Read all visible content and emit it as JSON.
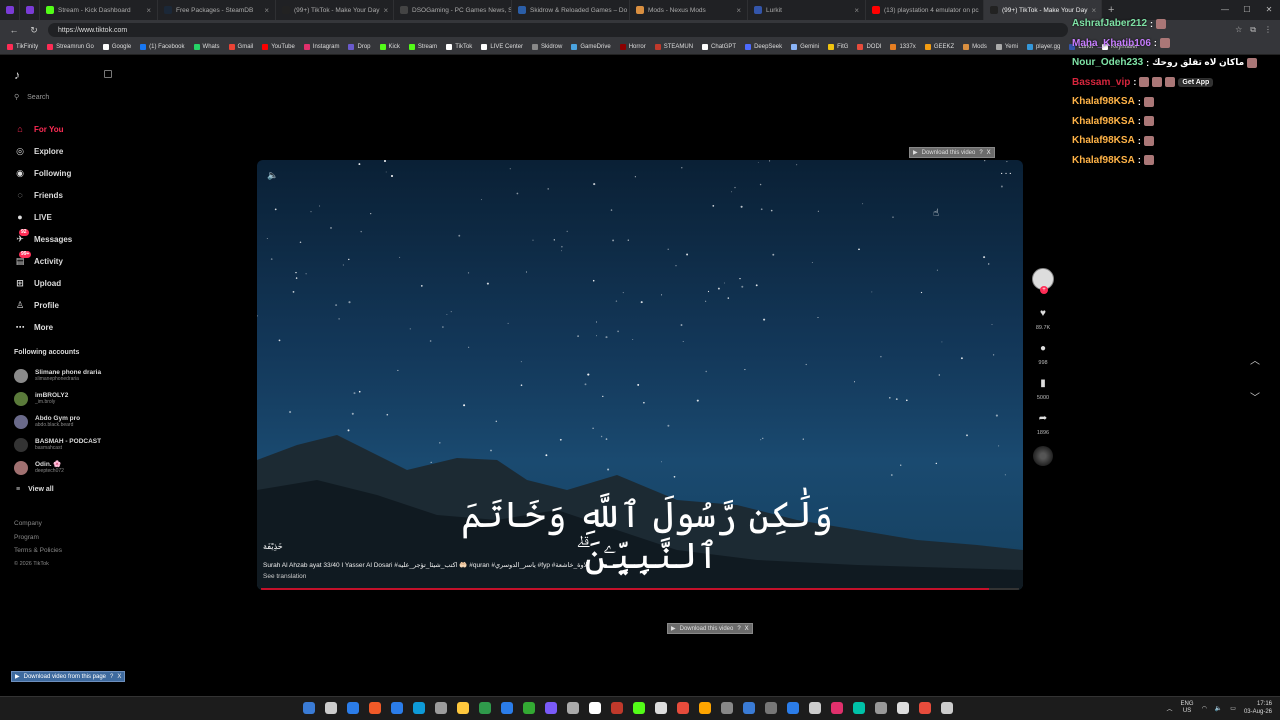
{
  "browser": {
    "tabs": [
      {
        "label": "",
        "color": "#7a3bd6"
      },
      {
        "label": "",
        "color": "#7a3bd6"
      },
      {
        "label": "Stream - Kick Dashboard",
        "color": "#53fc18"
      },
      {
        "label": "Free Packages - SteamDB",
        "color": "#1b2838"
      },
      {
        "label": "(99+) TikTok - Make Your Day",
        "color": "#222222"
      },
      {
        "label": "DSOGaming - PC Games News, S",
        "color": "#444444"
      },
      {
        "label": "Skidrow & Reloaded Games – Do",
        "color": "#2b5ea7"
      },
      {
        "label": "Mods - Nexus Mods",
        "color": "#d98f40"
      },
      {
        "label": "Lurkit",
        "color": "#3355aa"
      },
      {
        "label": "(13) playstation 4 emulator on pc",
        "color": "#ff0000"
      },
      {
        "label": "(99+) TikTok - Make Your Day",
        "color": "#222222"
      }
    ],
    "url": "https://www.tiktok.com",
    "bookmarks": [
      {
        "label": "TikFinity",
        "color": "#fe2c55"
      },
      {
        "label": "Streamrun Go",
        "color": "#fe2c55"
      },
      {
        "label": "Google",
        "color": "#ffffff"
      },
      {
        "label": "(1) Facebook",
        "color": "#1877f2"
      },
      {
        "label": "Whats",
        "color": "#25d366"
      },
      {
        "label": "Gmail",
        "color": "#ea4335"
      },
      {
        "label": "YouTube",
        "color": "#ff0000"
      },
      {
        "label": "Instagram",
        "color": "#e1306c"
      },
      {
        "label": "Drop",
        "color": "#6a5acd"
      },
      {
        "label": "Kick",
        "color": "#53fc18"
      },
      {
        "label": "Stream",
        "color": "#53fc18"
      },
      {
        "label": "TikTok",
        "color": "#ffffff"
      },
      {
        "label": "LIVE Center",
        "color": "#ffffff"
      },
      {
        "label": "Skidrow",
        "color": "#888888"
      },
      {
        "label": "GameDrive",
        "color": "#4aa3df"
      },
      {
        "label": "Horror",
        "color": "#8b0000"
      },
      {
        "label": "STEAMUN",
        "color": "#c0392b"
      },
      {
        "label": "ChatGPT",
        "color": "#ffffff"
      },
      {
        "label": "DeepSeek",
        "color": "#4d6bfe"
      },
      {
        "label": "Gemini",
        "color": "#8ab4f8"
      },
      {
        "label": "FitG",
        "color": "#f1c40f"
      },
      {
        "label": "DODI",
        "color": "#e74c3c"
      },
      {
        "label": "1337x",
        "color": "#e67e22"
      },
      {
        "label": "GEEKZ",
        "color": "#f39c12"
      },
      {
        "label": "Mods",
        "color": "#d98f40"
      },
      {
        "label": "Yemi",
        "color": "#aaaaaa"
      },
      {
        "label": "player.gg",
        "color": "#3498db"
      },
      {
        "label": "Lurkit",
        "color": "#3355aa"
      },
      {
        "label": "Keymailer",
        "color": "#ffffff"
      }
    ]
  },
  "sidebar": {
    "search_placeholder": "Search",
    "nav": [
      {
        "label": "For You",
        "icon": "home-icon",
        "glyph": "⌂",
        "active": true,
        "badge": ""
      },
      {
        "label": "Explore",
        "icon": "compass-icon",
        "glyph": "◎",
        "active": false,
        "badge": ""
      },
      {
        "label": "Following",
        "icon": "following-icon",
        "glyph": "◉",
        "active": false,
        "badge": ""
      },
      {
        "label": "Friends",
        "icon": "friends-icon",
        "glyph": "◌",
        "active": false,
        "badge": ""
      },
      {
        "label": "LIVE",
        "icon": "live-icon",
        "glyph": "●",
        "active": false,
        "badge": ""
      },
      {
        "label": "Messages",
        "icon": "messages-icon",
        "glyph": "✈",
        "active": false,
        "badge": "92"
      },
      {
        "label": "Activity",
        "icon": "activity-icon",
        "glyph": "▤",
        "active": false,
        "badge": "99+"
      },
      {
        "label": "Upload",
        "icon": "upload-icon",
        "glyph": "⊞",
        "active": false,
        "badge": ""
      },
      {
        "label": "Profile",
        "icon": "profile-icon",
        "glyph": "♙",
        "active": false,
        "badge": ""
      },
      {
        "label": "More",
        "icon": "more-icon",
        "glyph": "⋯",
        "active": false,
        "badge": ""
      }
    ],
    "following_title": "Following accounts",
    "accounts": [
      {
        "name": "Slimane phone draria",
        "handle": "slimanephonedraria"
      },
      {
        "name": "imBROLY2",
        "handle": "_im.broly"
      },
      {
        "name": "Abdo Gym pro",
        "handle": "abdo.black.beard"
      },
      {
        "name": "BASMAH - PODCAST",
        "handle": "basmahcast"
      },
      {
        "name": "Odin. 🌸",
        "handle": "deeptech072"
      }
    ],
    "view_all": "View all",
    "footer": {
      "company": "Company",
      "program": "Program",
      "terms": "Terms & Policies",
      "copyright": "© 2026 TikTok"
    }
  },
  "video": {
    "overlay_text": "وَلَٰكِن رَّسُولَ ٱللَّهِ وَخَاتَمَ ٱلنَّبِيِّـۧنَ ۗ",
    "author": "خَذِيْفَة",
    "caption": "Surah Al Ahzab ayat 33/40 I Yasser Al Dosari #اكتب_شيئا_تؤجر_عليه 🤲🏻 #quran #ياسر_الدوسري #fyp #تلاوة_خاشعة",
    "see_translation": "See translation",
    "progress": 0.96
  },
  "actions": {
    "likes": "89.7K",
    "comments": "998",
    "saves": "5000",
    "shares": "1896"
  },
  "download_buttons": {
    "video": "Download this video",
    "page": "Download video from this page",
    "q": "?",
    "x": "X"
  },
  "chat": [
    {
      "user": "AshrafJaber212",
      "color": "#7fe3a6",
      "msg": ""
    },
    {
      "user": "Maha_Khatib106",
      "color": "#c77dff",
      "msg": ""
    },
    {
      "user": "Nour_Odeh233",
      "color": "#7fe3a6",
      "msg": "ماكان لاه تقلق روحك"
    },
    {
      "user": "Bassam_vip",
      "color": "#d7263d",
      "msg": ""
    },
    {
      "user": "Khalaf98KSA",
      "color": "#ffb347",
      "msg": ""
    },
    {
      "user": "Khalaf98KSA",
      "color": "#ffb347",
      "msg": ""
    },
    {
      "user": "Khalaf98KSA",
      "color": "#ffb347",
      "msg": ""
    },
    {
      "user": "Khalaf98KSA",
      "color": "#ffb347",
      "msg": ""
    }
  ],
  "get_app": "Get App",
  "taskbar": {
    "lang_top": "ENG",
    "lang_bottom": "US",
    "time": "17:16",
    "date": "03-Aug-26",
    "icons": [
      "#3a7bd5",
      "#cccccc",
      "#2b7de9",
      "#f05a28",
      "#2b7de9",
      "#0e9bd8",
      "#9c9c9c",
      "#ffc83d",
      "#2f9a4b",
      "#2b7de9",
      "#33aa33",
      "#7a5af8",
      "#aaaaaa",
      "#ffffff",
      "#c0392b",
      "#53fc18",
      "#dddddd",
      "#e74c3c",
      "#ffa500",
      "#888888",
      "#3a7bd5",
      "#777777",
      "#2b7de9",
      "#cccccc",
      "#e1306c",
      "#00c2a8",
      "#999999",
      "#dddddd",
      "#e74c3c",
      "#cccccc"
    ]
  },
  "colors": {
    "accent": "#fe2c55"
  }
}
